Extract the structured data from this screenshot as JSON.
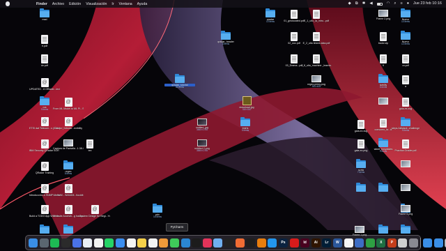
{
  "menubar": {
    "items": [
      "Finder",
      "Archivo",
      "Edición",
      "Visualización",
      "Ir",
      "Ventana",
      "Ayuda"
    ],
    "clock": "Jue 23 feb  10:16"
  },
  "desktop": {
    "items": [
      {
        "label": "mad",
        "sub": "",
        "kind": "folder"
      },
      {
        "label": "rl.pdf",
        "sub": "",
        "kind": "doc"
      },
      {
        "label": "dx.pdf",
        "sub": "",
        "kind": "doc"
      },
      {
        "label": "UPDATED - 8 GRader...lexibility",
        "sub": "",
        "kind": "at"
      },
      {
        "label": "ma",
        "sub": "9 items",
        "kind": "folder"
      },
      {
        "label": "From ML Model to ML Pi...Science",
        "sub": "",
        "kind": "at"
      },
      {
        "label": "ETSI dat Telecom...s (CAU)",
        "sub": "",
        "kind": "at"
      },
      {
        "label": "Colcon | Introdu...exibility",
        "sub": "",
        "kind": "at"
      },
      {
        "label": "IBM Security QRadar SOR | IBM",
        "sub": "",
        "kind": "at"
      },
      {
        "label": "Captura de Pantalla...1.38.44",
        "sub": "",
        "kind": "img"
      },
      {
        "label": "tex",
        "sub": "",
        "kind": "doc"
      },
      {
        "label": "QRadar Training",
        "sub": "",
        "kind": "at"
      },
      {
        "label": "regex",
        "sub": "8 items",
        "kind": "folder"
      },
      {
        "label": "Introducción a SNMP - ...Youtube",
        "sub": "",
        "kind": "at"
      },
      {
        "label": "WebbIM - WebbIM...tlockitt",
        "sub": "",
        "kind": "at"
      },
      {
        "label": "Build a TODO App With Jo...YouTube",
        "sub": "",
        "kind": "at"
      },
      {
        "label": "Website Accesib...g Issues",
        "sub": "",
        "kind": "at"
      },
      {
        "label": "System Design for Begi...YouTube",
        "sub": "",
        "kind": "at"
      },
      {
        "label": "",
        "sub": "",
        "kind": "folder"
      },
      {
        "label": "",
        "sub": "",
        "kind": "folder"
      },
      {
        "label": "qradar_header",
        "sub": "5 items",
        "kind": "folder"
      },
      {
        "label": "qradar_tutorial",
        "sub": "84 items",
        "kind": "folder"
      },
      {
        "label": "download.jpg",
        "sub": "310×310",
        "kind": "imgmap"
      },
      {
        "label": "untitled_jpg",
        "sub": "3840×1765",
        "kind": "imgdark"
      },
      {
        "label": "tmlrts",
        "sub": "5 items",
        "kind": "folder"
      },
      {
        "label": "untitled 2.png",
        "sub": "3840×1765",
        "kind": "imgdark"
      },
      {
        "label": "pdx",
        "sub": "16 items",
        "kind": "folder"
      },
      {
        "label": "qradar",
        "sub": "10 items",
        "kind": "folder"
      },
      {
        "label": "01_geolocated.pdf",
        "sub": "",
        "kind": "doc"
      },
      {
        "label": "E_1_ulto_la_intro...pdf",
        "sub": "",
        "kind": "doc"
      },
      {
        "label": "02_ooc.pdf",
        "sub": "",
        "kind": "doc"
      },
      {
        "label": "E_2_ulto linked-data.pdf",
        "sub": "",
        "kind": "doc"
      },
      {
        "label": "03_Drama...pdf",
        "sub": "",
        "kind": "doc"
      },
      {
        "label": "1_8_ulto_machine _learnin...otro.pdf",
        "sub": "",
        "kind": "doc"
      },
      {
        "label": "regex-prexy.png",
        "sub": "900×603",
        "kind": "img"
      },
      {
        "label": "gaia-ec.svg",
        "sub": "",
        "kind": "doc"
      },
      {
        "label": "gaia-ec.png",
        "sub": "",
        "kind": "doc"
      },
      {
        "label": "scrta",
        "sub": "7 items",
        "kind": "folder"
      },
      {
        "label": "Frame 2.png",
        "sub": "",
        "kind": "img"
      },
      {
        "label": "bsdor.zip",
        "sub": "",
        "kind": "doc"
      },
      {
        "label": "9",
        "sub": "",
        "kind": "doc"
      },
      {
        "label": "tarbilly",
        "sub": "5 items",
        "kind": "folder"
      },
      {
        "label": "",
        "sub": "",
        "kind": "img"
      },
      {
        "label": "consumo_la...ix",
        "sub": "",
        "kind": "doc"
      },
      {
        "label": "wkmt_hospitales",
        "sub": "9 items",
        "kind": "folder"
      },
      {
        "label": "Nuevo",
        "sub": "14 items",
        "kind": "folder"
      },
      {
        "label": "Nuevo",
        "sub": "14 items",
        "kind": "folder"
      },
      {
        "label": "cv.pdf",
        "sub": "",
        "kind": "doc"
      },
      {
        "label": "a",
        "sub": "",
        "kind": "doc"
      },
      {
        "label": "gaia-es.svg",
        "sub": "",
        "kind": "doc"
      },
      {
        "label": "steps-fullstack -challenge",
        "sub": "9 items",
        "kind": "folder"
      },
      {
        "label": "Practica Grader.pdf",
        "sub": "",
        "kind": "doc"
      },
      {
        "label": "",
        "sub": "",
        "kind": "img"
      },
      {
        "label": "",
        "sub": "",
        "kind": "img"
      },
      {
        "label": "",
        "sub": "",
        "kind": "folder"
      },
      {
        "label": "",
        "sub": "",
        "kind": "folder"
      },
      {
        "label": "",
        "sub": "",
        "kind": "folder"
      },
      {
        "label": "Frame 1.png",
        "sub": "",
        "kind": "img"
      },
      {
        "label": "Frame 5.png",
        "sub": "",
        "kind": "img"
      },
      {
        "label": "",
        "sub": "",
        "kind": "folder"
      },
      {
        "label": "",
        "sub": "",
        "kind": "folder"
      }
    ]
  },
  "tooltip": "PyCharm",
  "dock": {
    "apps": [
      {
        "name": "finder",
        "color": "#3a8ee6",
        "glyph": ""
      },
      {
        "name": "launchpad",
        "color": "#5a6670",
        "glyph": ""
      },
      {
        "name": "spotify",
        "color": "#1db954",
        "glyph": ""
      },
      {
        "name": "music",
        "color": "#2b2b2b",
        "glyph": ""
      },
      {
        "name": "ticktick",
        "color": "#4a72e8",
        "glyph": ""
      },
      {
        "name": "safari",
        "color": "#e9eef5",
        "glyph": ""
      },
      {
        "name": "chrome",
        "color": "#f2f2f2",
        "glyph": ""
      },
      {
        "name": "whatsapp",
        "color": "#25d366",
        "glyph": ""
      },
      {
        "name": "mail",
        "color": "#3b8ef0",
        "glyph": ""
      },
      {
        "name": "calendar",
        "color": "#f4f4f4",
        "glyph": ""
      },
      {
        "name": "notes",
        "color": "#f7d14a",
        "glyph": ""
      },
      {
        "name": "reminders",
        "color": "#f4f4f4",
        "glyph": ""
      },
      {
        "name": "photos",
        "color": "#f09a3a",
        "glyph": ""
      },
      {
        "name": "messages",
        "color": "#3fca5a",
        "glyph": ""
      },
      {
        "name": "vscode",
        "color": "#2b86d2",
        "glyph": ""
      },
      {
        "name": "pycharm",
        "color": "#1c1c1c",
        "glyph": ""
      },
      {
        "name": "intellij",
        "color": "#e3335a",
        "glyph": ""
      },
      {
        "name": "preview",
        "color": "#6fb0f0",
        "glyph": ""
      },
      {
        "name": "terminal",
        "color": "#222222",
        "glyph": ""
      },
      {
        "name": "postman",
        "color": "#ef6c34",
        "glyph": ""
      },
      {
        "name": "figma",
        "color": "#1e1e1e",
        "glyph": ""
      },
      {
        "name": "blender",
        "color": "#e87d0d",
        "glyph": ""
      },
      {
        "name": "docker",
        "color": "#2396ed",
        "glyph": ""
      },
      {
        "name": "photoshop",
        "color": "#0b2340",
        "glyph": "Ps"
      },
      {
        "name": "acrobat",
        "color": "#d81b1b",
        "glyph": ""
      },
      {
        "name": "indesign",
        "color": "#49021f",
        "glyph": "Id"
      },
      {
        "name": "illustrator",
        "color": "#2f1500",
        "glyph": "Ai"
      },
      {
        "name": "lightroom",
        "color": "#001e36",
        "glyph": "Lr"
      },
      {
        "name": "word",
        "color": "#2b579a",
        "glyph": "W"
      },
      {
        "name": "notion",
        "color": "#f4f4f4",
        "glyph": "N"
      },
      {
        "name": "tableau",
        "color": "#3d6dc4",
        "glyph": ""
      },
      {
        "name": "numbers",
        "color": "#2ea043",
        "glyph": ""
      },
      {
        "name": "excel",
        "color": "#1d6f42",
        "glyph": "X"
      },
      {
        "name": "powerpoint",
        "color": "#c43e1c",
        "glyph": "P"
      },
      {
        "name": "nordvpn",
        "color": "#cfcfcf",
        "glyph": ""
      },
      {
        "name": "system-settings",
        "color": "#8a8a92",
        "glyph": ""
      },
      {
        "name": "downloads-folder",
        "color": "#3a8ee6",
        "glyph": ""
      },
      {
        "name": "app-folder",
        "color": "#3a8ee6",
        "glyph": ""
      },
      {
        "name": "trash",
        "color": "#b8bcc4",
        "glyph": ""
      }
    ]
  }
}
